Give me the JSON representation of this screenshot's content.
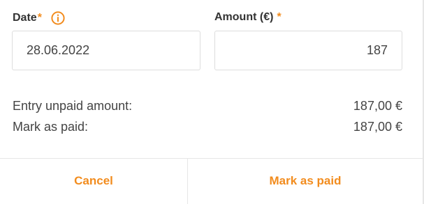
{
  "colors": {
    "accent": "#f28c1e",
    "text": "#444444",
    "border": "#dddddd"
  },
  "form": {
    "date": {
      "label": "Date",
      "required_marker": "*",
      "info_icon": "info-circle-icon",
      "value": "28.06.2022"
    },
    "amount": {
      "label": "Amount (€)",
      "required_marker": "*",
      "value": "187"
    }
  },
  "summary": {
    "unpaid_label": "Entry unpaid amount:",
    "unpaid_value": "187,00 €",
    "paid_label": "Mark as paid:",
    "paid_value": "187,00 €"
  },
  "footer": {
    "cancel_label": "Cancel",
    "confirm_label": "Mark as paid"
  }
}
